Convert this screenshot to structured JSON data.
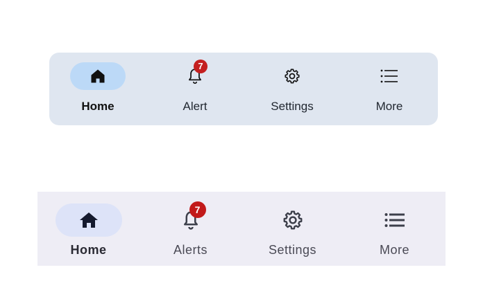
{
  "nav_a": {
    "items": [
      {
        "label": "Home",
        "icon": "home-icon",
        "active": true
      },
      {
        "label": "Alert",
        "icon": "bell-icon",
        "badge": "7"
      },
      {
        "label": "Settings",
        "icon": "gear-icon"
      },
      {
        "label": "More",
        "icon": "list-icon"
      }
    ],
    "colors": {
      "background": "#dfe6f0",
      "active_pill": "#bcd9f7",
      "badge": "#c42020"
    }
  },
  "nav_b": {
    "items": [
      {
        "label": "Home",
        "icon": "home-icon",
        "active": true
      },
      {
        "label": "Alerts",
        "icon": "bell-icon",
        "badge": "7"
      },
      {
        "label": "Settings",
        "icon": "gear-icon"
      },
      {
        "label": "More",
        "icon": "list-icon"
      }
    ],
    "colors": {
      "background": "#eeedf5",
      "active_pill": "#dde3f8",
      "badge": "#c21a1a"
    }
  }
}
